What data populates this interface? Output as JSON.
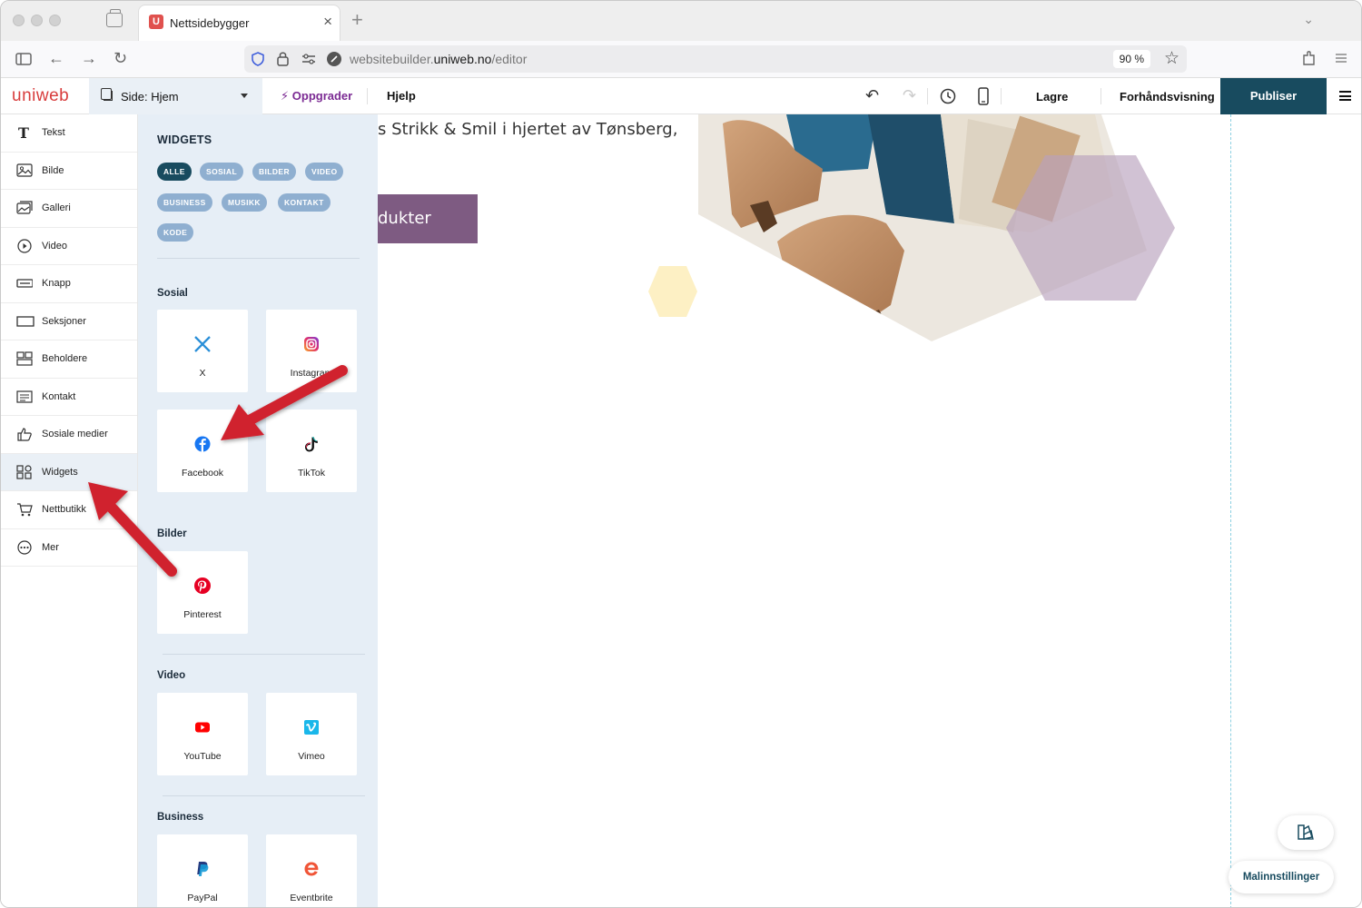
{
  "browser": {
    "tab_title": "Nettsidebygger",
    "tab_favicon_letter": "U",
    "url_domain_prefix": "websitebuilder.",
    "url_domain": "uniweb.no",
    "url_path": "/editor",
    "zoom": "90 %"
  },
  "app": {
    "logo": "uniweb",
    "page_selector": "Side: Hjem",
    "upgrade": "Oppgrader",
    "help": "Hjelp",
    "save": "Lagre",
    "preview": "Forhåndsvisning",
    "publish": "Publiser"
  },
  "sidebar": {
    "items": [
      {
        "label": "Tekst",
        "icon": "text-icon"
      },
      {
        "label": "Bilde",
        "icon": "image-icon"
      },
      {
        "label": "Galleri",
        "icon": "gallery-icon"
      },
      {
        "label": "Video",
        "icon": "video-icon"
      },
      {
        "label": "Knapp",
        "icon": "button-icon"
      },
      {
        "label": "Seksjoner",
        "icon": "section-icon"
      },
      {
        "label": "Beholdere",
        "icon": "container-icon"
      },
      {
        "label": "Kontakt",
        "icon": "contact-icon"
      },
      {
        "label": "Sosiale medier",
        "icon": "thumbs-up-icon"
      },
      {
        "label": "Widgets",
        "icon": "widgets-icon",
        "active": true
      },
      {
        "label": "Nettbutikk",
        "icon": "cart-icon"
      },
      {
        "label": "Mer",
        "icon": "more-icon"
      }
    ]
  },
  "panel": {
    "title": "WIDGETS",
    "filters": [
      "ALLE",
      "SOSIAL",
      "BILDER",
      "VIDEO",
      "BUSINESS",
      "MUSIKK",
      "KONTAKT",
      "KODE"
    ],
    "active_filter": "ALLE",
    "sections": [
      {
        "title": "Sosial",
        "widgets": [
          "X",
          "Instagram",
          "Facebook",
          "TikTok"
        ]
      },
      {
        "title": "Bilder",
        "widgets": [
          "Pinterest"
        ]
      },
      {
        "title": "Video",
        "widgets": [
          "YouTube",
          "Vimeo"
        ]
      },
      {
        "title": "Business",
        "widgets": [
          "PayPal",
          "Eventbrite"
        ]
      }
    ]
  },
  "canvas": {
    "hero_text": "s Strikk & Smil i hjertet av Tønsberg,",
    "hero_button": "dukter",
    "template_settings": "Malinnstillinger"
  },
  "colors": {
    "brand_dark": "#184b5f",
    "chip": "#8fafd0",
    "panel_bg": "#e6eef6",
    "upgrade": "#7b2a93",
    "hero_button": "#7e5b82",
    "annotation_arrow": "#d0202e"
  }
}
